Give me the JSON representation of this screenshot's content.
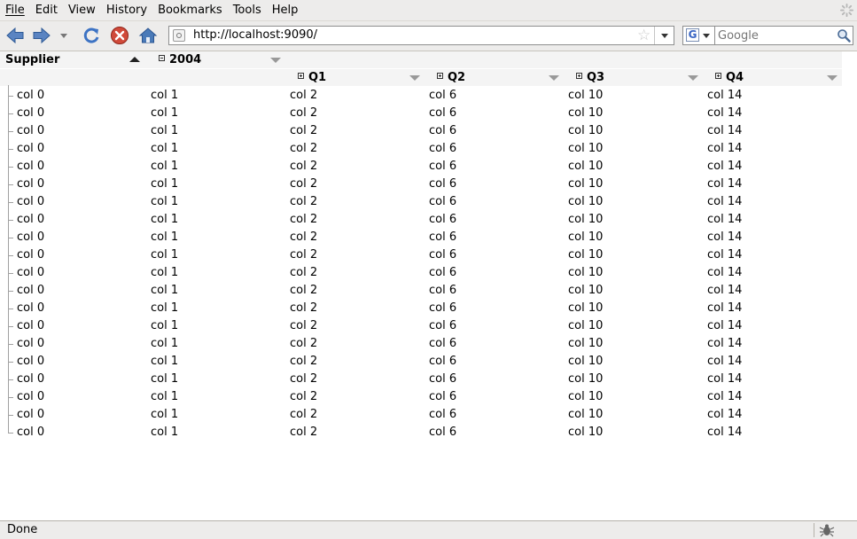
{
  "menubar": {
    "items": [
      "File",
      "Edit",
      "View",
      "History",
      "Bookmarks",
      "Tools",
      "Help"
    ]
  },
  "toolbar": {
    "url": "http://localhost:9090/",
    "search_placeholder": "Google"
  },
  "table": {
    "headers": {
      "supplier": "Supplier",
      "year": "2004",
      "quarters": [
        "Q1",
        "Q2",
        "Q3",
        "Q4"
      ]
    },
    "rows": [
      [
        "col 0",
        "col 1",
        "col 2",
        "col 6",
        "col 10",
        "col 14"
      ],
      [
        "col 0",
        "col 1",
        "col 2",
        "col 6",
        "col 10",
        "col 14"
      ],
      [
        "col 0",
        "col 1",
        "col 2",
        "col 6",
        "col 10",
        "col 14"
      ],
      [
        "col 0",
        "col 1",
        "col 2",
        "col 6",
        "col 10",
        "col 14"
      ],
      [
        "col 0",
        "col 1",
        "col 2",
        "col 6",
        "col 10",
        "col 14"
      ],
      [
        "col 0",
        "col 1",
        "col 2",
        "col 6",
        "col 10",
        "col 14"
      ],
      [
        "col 0",
        "col 1",
        "col 2",
        "col 6",
        "col 10",
        "col 14"
      ],
      [
        "col 0",
        "col 1",
        "col 2",
        "col 6",
        "col 10",
        "col 14"
      ],
      [
        "col 0",
        "col 1",
        "col 2",
        "col 6",
        "col 10",
        "col 14"
      ],
      [
        "col 0",
        "col 1",
        "col 2",
        "col 6",
        "col 10",
        "col 14"
      ],
      [
        "col 0",
        "col 1",
        "col 2",
        "col 6",
        "col 10",
        "col 14"
      ],
      [
        "col 0",
        "col 1",
        "col 2",
        "col 6",
        "col 10",
        "col 14"
      ],
      [
        "col 0",
        "col 1",
        "col 2",
        "col 6",
        "col 10",
        "col 14"
      ],
      [
        "col 0",
        "col 1",
        "col 2",
        "col 6",
        "col 10",
        "col 14"
      ],
      [
        "col 0",
        "col 1",
        "col 2",
        "col 6",
        "col 10",
        "col 14"
      ],
      [
        "col 0",
        "col 1",
        "col 2",
        "col 6",
        "col 10",
        "col 14"
      ],
      [
        "col 0",
        "col 1",
        "col 2",
        "col 6",
        "col 10",
        "col 14"
      ],
      [
        "col 0",
        "col 1",
        "col 2",
        "col 6",
        "col 10",
        "col 14"
      ],
      [
        "col 0",
        "col 1",
        "col 2",
        "col 6",
        "col 10",
        "col 14"
      ],
      [
        "col 0",
        "col 1",
        "col 2",
        "col 6",
        "col 10",
        "col 14"
      ]
    ]
  },
  "status": {
    "text": "Done"
  },
  "colors": {
    "chrome": "#edeceb",
    "header_bg": "#f4f4f4",
    "nav_blue": "#4a7ab8",
    "stop_red": "#c0392b"
  }
}
